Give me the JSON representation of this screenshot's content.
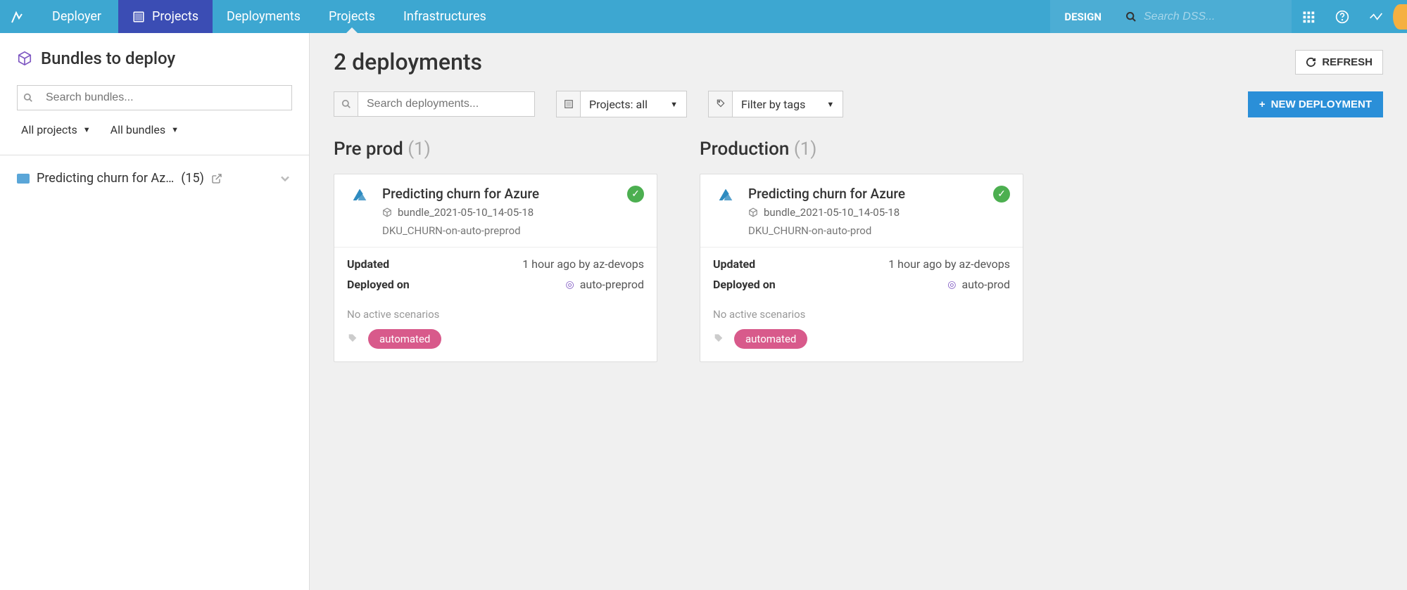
{
  "topbar": {
    "app_title": "Deployer",
    "nav": {
      "projects_main": "Projects",
      "deployments": "Deployments",
      "projects_sub": "Projects",
      "infrastructures": "Infrastructures"
    },
    "mode": "DESIGN",
    "search_placeholder": "Search DSS..."
  },
  "sidebar": {
    "title": "Bundles to deploy",
    "search_placeholder": "Search bundles...",
    "filter_projects": "All projects",
    "filter_bundles": "All bundles",
    "items": [
      {
        "name": "Predicting churn for Az…",
        "count": "(15)"
      }
    ]
  },
  "content": {
    "title": "2 deployments",
    "refresh_label": "REFRESH",
    "search_placeholder": "Search deployments...",
    "filter_projects": "Projects: all",
    "filter_tags": "Filter by tags",
    "new_deployment_label": "NEW DEPLOYMENT",
    "environments": [
      {
        "name": "Pre prod",
        "count": "(1)",
        "card": {
          "title": "Predicting churn for Azure",
          "bundle": "bundle_2021-05-10_14-05-18",
          "deploy_id": "DKU_CHURN-on-auto-preprod",
          "updated_label": "Updated",
          "updated_val": "1 hour ago by az-devops",
          "deployed_label": "Deployed on",
          "deployed_val": "auto-preprod",
          "scenario_text": "No active scenarios",
          "tag": "automated"
        }
      },
      {
        "name": "Production",
        "count": "(1)",
        "card": {
          "title": "Predicting churn for Azure",
          "bundle": "bundle_2021-05-10_14-05-18",
          "deploy_id": "DKU_CHURN-on-auto-prod",
          "updated_label": "Updated",
          "updated_val": "1 hour ago by az-devops",
          "deployed_label": "Deployed on",
          "deployed_val": "auto-prod",
          "scenario_text": "No active scenarios",
          "tag": "automated"
        }
      }
    ]
  }
}
